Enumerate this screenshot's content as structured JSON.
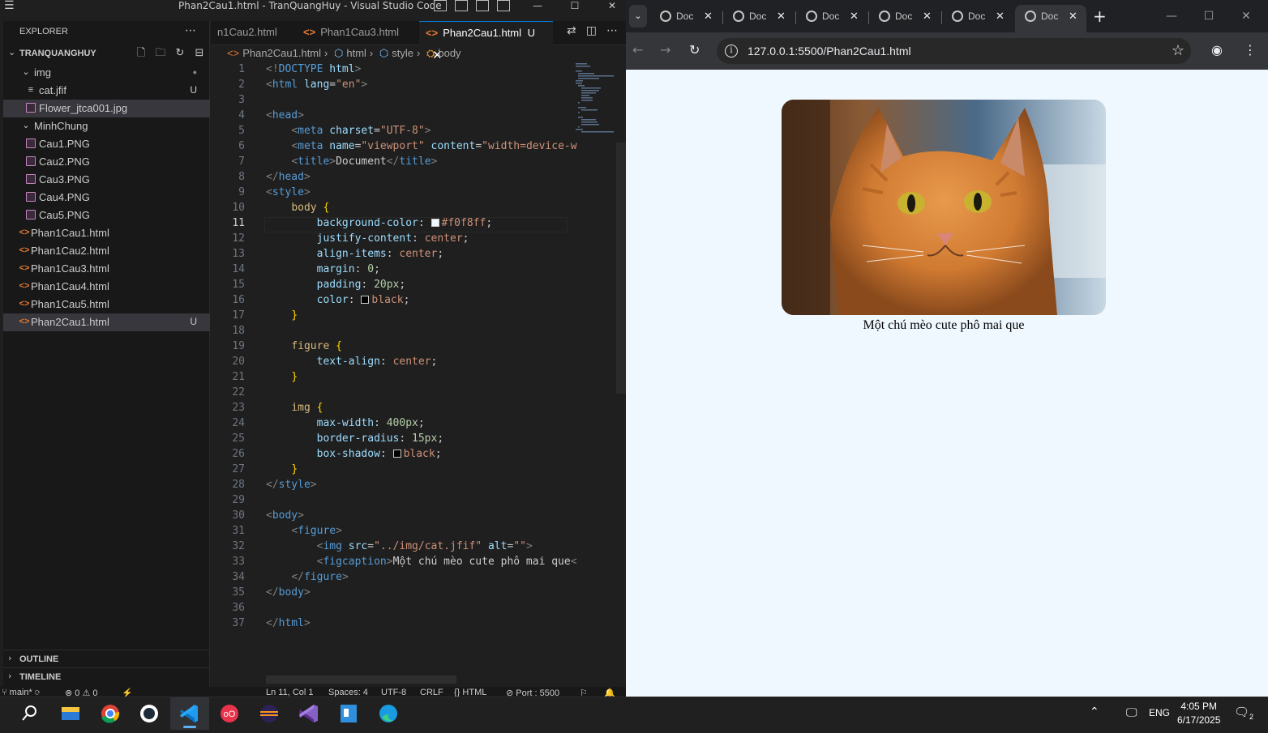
{
  "vscode": {
    "title": "Phan2Cau1.html - TranQuangHuy - Visual Studio Code",
    "window_controls": [
      "—",
      "☐",
      "✕"
    ],
    "explorer_label": "EXPLORER",
    "workspace": "TRANQUANGHUY",
    "tree": [
      {
        "label": "img",
        "type": "folder",
        "badge": "●"
      },
      {
        "label": "cat.jfif",
        "type": "file",
        "badge": "U"
      },
      {
        "label": "Flower_jtca001.jpg",
        "type": "image",
        "badge": ""
      },
      {
        "label": "MinhChung",
        "type": "folder",
        "badge": ""
      },
      {
        "label": "Cau1.PNG",
        "type": "image",
        "badge": ""
      },
      {
        "label": "Cau2.PNG",
        "type": "image",
        "badge": ""
      },
      {
        "label": "Cau3.PNG",
        "type": "image",
        "badge": ""
      },
      {
        "label": "Cau4.PNG",
        "type": "image",
        "badge": ""
      },
      {
        "label": "Cau5.PNG",
        "type": "image",
        "badge": ""
      },
      {
        "label": "Phan1Cau1.html",
        "type": "html",
        "badge": ""
      },
      {
        "label": "Phan1Cau2.html",
        "type": "html",
        "badge": ""
      },
      {
        "label": "Phan1Cau3.html",
        "type": "html",
        "badge": ""
      },
      {
        "label": "Phan1Cau4.html",
        "type": "html",
        "badge": ""
      },
      {
        "label": "Phan1Cau5.html",
        "type": "html",
        "badge": ""
      },
      {
        "label": "Phan2Cau1.html",
        "type": "html",
        "badge": "U"
      }
    ],
    "outline_label": "OUTLINE",
    "timeline_label": "TIMELINE",
    "tabs": [
      {
        "label": "n1Cau2.html",
        "active": false
      },
      {
        "label": "Phan1Cau3.html",
        "active": false
      },
      {
        "label": "Phan2Cau1.html",
        "active": true,
        "badge": "U"
      }
    ],
    "breadcrumb": [
      "Phan2Cau1.html",
      "html",
      "style",
      "body"
    ],
    "current_line": 11,
    "status": {
      "branch": "main*",
      "problems": "⊗ 0 ⚠ 0",
      "position": "Ln 11, Col 1",
      "spaces": "Spaces: 4",
      "encoding": "UTF-8",
      "eol": "CRLF",
      "language": "HTML",
      "port": "Port : 5500"
    }
  },
  "code_lines": [
    [
      [
        "pt",
        "<!"
      ],
      [
        "tg",
        "DOCTYPE"
      ],
      [
        "tx",
        " "
      ],
      [
        "at",
        "html"
      ],
      [
        "pt",
        ">"
      ]
    ],
    [
      [
        "pt",
        "<"
      ],
      [
        "tg",
        "html"
      ],
      [
        "tx",
        " "
      ],
      [
        "at",
        "lang"
      ],
      [
        "tx",
        "="
      ],
      [
        "st",
        "\"en\""
      ],
      [
        "pt",
        ">"
      ]
    ],
    [],
    [
      [
        "pt",
        "<"
      ],
      [
        "tg",
        "head"
      ],
      [
        "pt",
        ">"
      ]
    ],
    [
      [
        "tx",
        "    "
      ],
      [
        "pt",
        "<"
      ],
      [
        "tg",
        "meta"
      ],
      [
        "tx",
        " "
      ],
      [
        "at",
        "charset"
      ],
      [
        "tx",
        "="
      ],
      [
        "st",
        "\"UTF-8\""
      ],
      [
        "pt",
        ">"
      ]
    ],
    [
      [
        "tx",
        "    "
      ],
      [
        "pt",
        "<"
      ],
      [
        "tg",
        "meta"
      ],
      [
        "tx",
        " "
      ],
      [
        "at",
        "name"
      ],
      [
        "tx",
        "="
      ],
      [
        "st",
        "\"viewport\""
      ],
      [
        "tx",
        " "
      ],
      [
        "at",
        "content"
      ],
      [
        "tx",
        "="
      ],
      [
        "st",
        "\"width=device-w"
      ]
    ],
    [
      [
        "tx",
        "    "
      ],
      [
        "pt",
        "<"
      ],
      [
        "tg",
        "title"
      ],
      [
        "pt",
        ">"
      ],
      [
        "tx",
        "Document"
      ],
      [
        "pt",
        "</"
      ],
      [
        "tg",
        "title"
      ],
      [
        "pt",
        ">"
      ]
    ],
    [
      [
        "pt",
        "</"
      ],
      [
        "tg",
        "head"
      ],
      [
        "pt",
        ">"
      ]
    ],
    [
      [
        "pt",
        "<"
      ],
      [
        "tg",
        "style"
      ],
      [
        "pt",
        ">"
      ]
    ],
    [
      [
        "tx",
        "    "
      ],
      [
        "sel-css",
        "body"
      ],
      [
        "tx",
        " "
      ],
      [
        "br",
        "{"
      ]
    ],
    [
      [
        "tx",
        "        "
      ],
      [
        "prop",
        "background-color"
      ],
      [
        "tx",
        ": "
      ],
      [
        "sw",
        "#f0f8ff"
      ],
      [
        "val",
        "#f0f8ff"
      ],
      [
        "tx",
        ";"
      ]
    ],
    [
      [
        "tx",
        "        "
      ],
      [
        "prop",
        "justify-content"
      ],
      [
        "tx",
        ": "
      ],
      [
        "val",
        "center"
      ],
      [
        "tx",
        ";"
      ]
    ],
    [
      [
        "tx",
        "        "
      ],
      [
        "prop",
        "align-items"
      ],
      [
        "tx",
        ": "
      ],
      [
        "val",
        "center"
      ],
      [
        "tx",
        ";"
      ]
    ],
    [
      [
        "tx",
        "        "
      ],
      [
        "prop",
        "margin"
      ],
      [
        "tx",
        ": "
      ],
      [
        "num",
        "0"
      ],
      [
        "tx",
        ";"
      ]
    ],
    [
      [
        "tx",
        "        "
      ],
      [
        "prop",
        "padding"
      ],
      [
        "tx",
        ": "
      ],
      [
        "num",
        "20px"
      ],
      [
        "tx",
        ";"
      ]
    ],
    [
      [
        "tx",
        "        "
      ],
      [
        "prop",
        "color"
      ],
      [
        "tx",
        ": "
      ],
      [
        "sw",
        "#000000"
      ],
      [
        "val",
        "black"
      ],
      [
        "tx",
        ";"
      ]
    ],
    [
      [
        "tx",
        "    "
      ],
      [
        "br",
        "}"
      ]
    ],
    [],
    [
      [
        "tx",
        "    "
      ],
      [
        "sel-css",
        "figure"
      ],
      [
        "tx",
        " "
      ],
      [
        "br",
        "{"
      ]
    ],
    [
      [
        "tx",
        "        "
      ],
      [
        "prop",
        "text-align"
      ],
      [
        "tx",
        ": "
      ],
      [
        "val",
        "center"
      ],
      [
        "tx",
        ";"
      ]
    ],
    [
      [
        "tx",
        "    "
      ],
      [
        "br",
        "}"
      ]
    ],
    [],
    [
      [
        "tx",
        "    "
      ],
      [
        "sel-css",
        "img"
      ],
      [
        "tx",
        " "
      ],
      [
        "br",
        "{"
      ]
    ],
    [
      [
        "tx",
        "        "
      ],
      [
        "prop",
        "max-width"
      ],
      [
        "tx",
        ": "
      ],
      [
        "num",
        "400px"
      ],
      [
        "tx",
        ";"
      ]
    ],
    [
      [
        "tx",
        "        "
      ],
      [
        "prop",
        "border-radius"
      ],
      [
        "tx",
        ": "
      ],
      [
        "num",
        "15px"
      ],
      [
        "tx",
        ";"
      ]
    ],
    [
      [
        "tx",
        "        "
      ],
      [
        "prop",
        "box-shadow"
      ],
      [
        "tx",
        ": "
      ],
      [
        "sw",
        "#000000"
      ],
      [
        "val",
        "black"
      ],
      [
        "tx",
        ";"
      ]
    ],
    [
      [
        "tx",
        "    "
      ],
      [
        "br",
        "}"
      ]
    ],
    [
      [
        "pt",
        "</"
      ],
      [
        "tg",
        "style"
      ],
      [
        "pt",
        ">"
      ]
    ],
    [],
    [
      [
        "pt",
        "<"
      ],
      [
        "tg",
        "body"
      ],
      [
        "pt",
        ">"
      ]
    ],
    [
      [
        "tx",
        "    "
      ],
      [
        "pt",
        "<"
      ],
      [
        "tg",
        "figure"
      ],
      [
        "pt",
        ">"
      ]
    ],
    [
      [
        "tx",
        "        "
      ],
      [
        "pt",
        "<"
      ],
      [
        "tg",
        "img"
      ],
      [
        "tx",
        " "
      ],
      [
        "at",
        "src"
      ],
      [
        "tx",
        "="
      ],
      [
        "st",
        "\"../img/cat.jfif\""
      ],
      [
        "tx",
        " "
      ],
      [
        "at",
        "alt"
      ],
      [
        "tx",
        "="
      ],
      [
        "st",
        "\"\""
      ],
      [
        "pt",
        ">"
      ]
    ],
    [
      [
        "tx",
        "        "
      ],
      [
        "pt",
        "<"
      ],
      [
        "tg",
        "figcaption"
      ],
      [
        "pt",
        ">"
      ],
      [
        "tx",
        "Một chú mèo cute phô mai que"
      ],
      [
        "pt",
        "<"
      ]
    ],
    [
      [
        "tx",
        "    "
      ],
      [
        "pt",
        "</"
      ],
      [
        "tg",
        "figure"
      ],
      [
        "pt",
        ">"
      ]
    ],
    [
      [
        "pt",
        "</"
      ],
      [
        "tg",
        "body"
      ],
      [
        "pt",
        ">"
      ]
    ],
    [],
    [
      [
        "pt",
        "</"
      ],
      [
        "tg",
        "html"
      ],
      [
        "pt",
        ">"
      ]
    ]
  ],
  "browser": {
    "tab_title": "Doc",
    "tab_count": 6,
    "url": "127.0.0.1:5500/Phan2Cau1.html",
    "page": {
      "background": "#f0f8ff",
      "caption": "Một chú mèo cute phô mai que"
    }
  },
  "taskbar": {
    "apps": [
      "search",
      "file-explorer",
      "chrome",
      "whatsapp",
      "vscode",
      "app-red",
      "eclipse",
      "visual-studio",
      "app-blue",
      "edge"
    ],
    "active_app": "vscode",
    "lang": "ENG",
    "time": "4:05 PM",
    "date": "6/17/2025",
    "notification_count": "2"
  }
}
